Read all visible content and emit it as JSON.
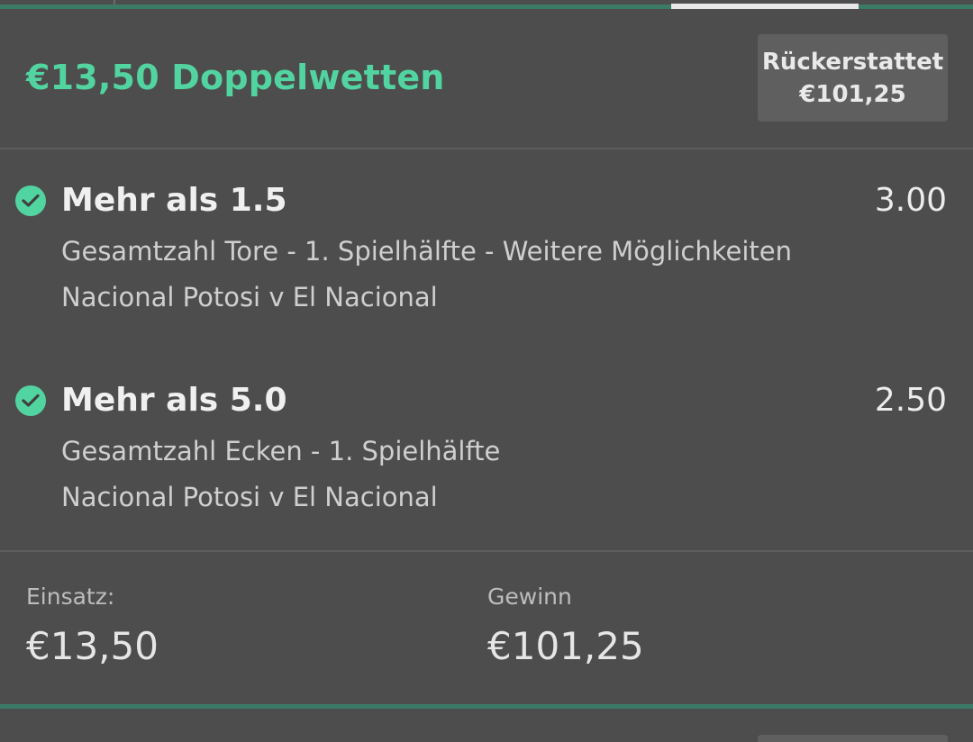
{
  "bet": {
    "title": "€13,50 Doppelwetten",
    "refund_label": "Rückerstattet",
    "refund_amount": "€101,25"
  },
  "selections": [
    {
      "name": "Mehr als 1.5",
      "odds": "3.00",
      "market": "Gesamtzahl Tore - 1. Spielhälfte - Weitere Möglichkeiten",
      "event": "Nacional Potosi v El Nacional",
      "status_icon": "check-circle-icon"
    },
    {
      "name": "Mehr als 5.0",
      "odds": "2.50",
      "market": "Gesamtzahl Ecken - 1. Spielhälfte",
      "event": "Nacional Potosi v El Nacional",
      "status_icon": "check-circle-icon"
    }
  ],
  "footer": {
    "stake_label": "Einsatz:",
    "stake_value": "€13,50",
    "win_label": "Gewinn",
    "win_value": "€101,25"
  },
  "colors": {
    "accent": "#52d4a1",
    "background": "#4d4d4d",
    "panel": "#5f5f5f"
  }
}
